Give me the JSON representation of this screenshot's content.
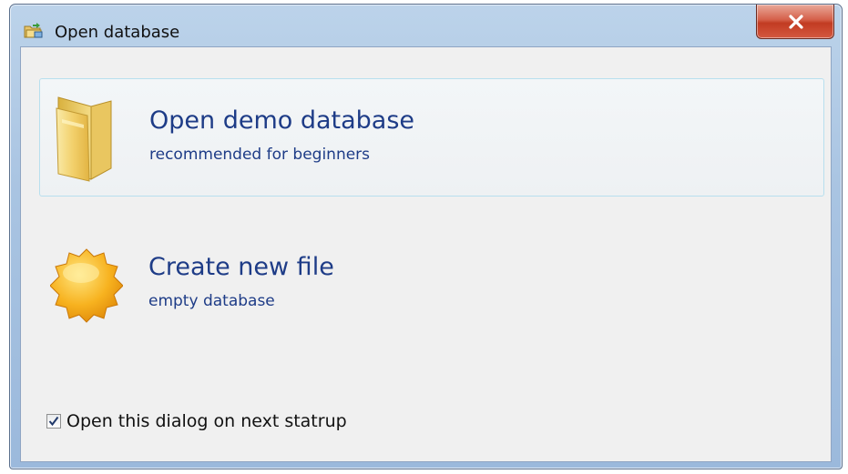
{
  "window": {
    "title": "Open database",
    "title_icon": "database-open-icon",
    "close_icon": "close-icon"
  },
  "options": [
    {
      "title": "Open demo database",
      "subtitle": "recommended for beginners",
      "icon": "folder-icon",
      "highlighted": true
    },
    {
      "title": "Create new file",
      "subtitle": "empty database",
      "icon": "new-starburst-icon",
      "highlighted": false
    }
  ],
  "startup_checkbox": {
    "label": "Open this dialog on next statrup",
    "checked": true
  },
  "colors": {
    "link_text": "#1e3c87",
    "client_bg": "#f0f0f0",
    "close_button": "#c23b22"
  }
}
